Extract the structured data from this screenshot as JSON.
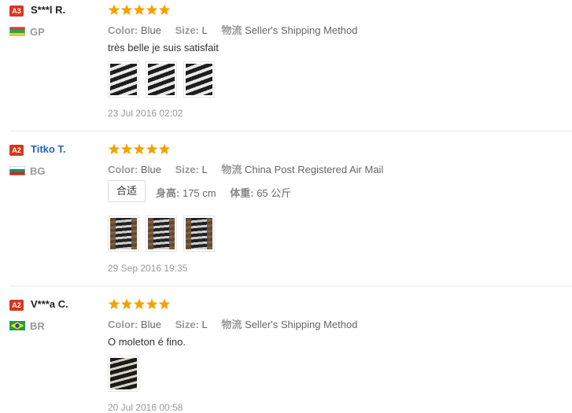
{
  "reviews": [
    {
      "level": "A3",
      "name": "S***l R.",
      "country": "GP",
      "rating": 5,
      "color_label": "Color:",
      "color": "Blue",
      "size_label": "Size:",
      "size": "L",
      "shipping_label": "物流",
      "shipping": "Seller's Shipping Method",
      "text": "très belle je suis satisfait",
      "photos": 3,
      "date": "23 Jul 2016 02:02"
    },
    {
      "level": "A2",
      "name": "Titko T.",
      "country": "BG",
      "rating": 5,
      "color_label": "Color:",
      "color": "Blue",
      "size_label": "Size:",
      "size": "L",
      "shipping_label": "物流",
      "shipping": "China Post Registered Air Mail",
      "fit_tag": "合适",
      "height_label": "身高:",
      "height": "175 cm",
      "weight_label": "体重:",
      "weight": "65 公斤",
      "photos": 3,
      "date": "29 Sep 2016 19:35"
    },
    {
      "level": "A2",
      "name": "V***a C.",
      "country": "BR",
      "rating": 5,
      "color_label": "Color:",
      "color": "Blue",
      "size_label": "Size:",
      "size": "L",
      "shipping_label": "物流",
      "shipping": "Seller's Shipping Method",
      "text": "O moleton é fino.",
      "photos": 1,
      "date": "20 Jul 2016 00:58"
    }
  ],
  "colors": {
    "star": "#f5a000",
    "level_badge": "#d9361f",
    "link": "#2463b8"
  }
}
